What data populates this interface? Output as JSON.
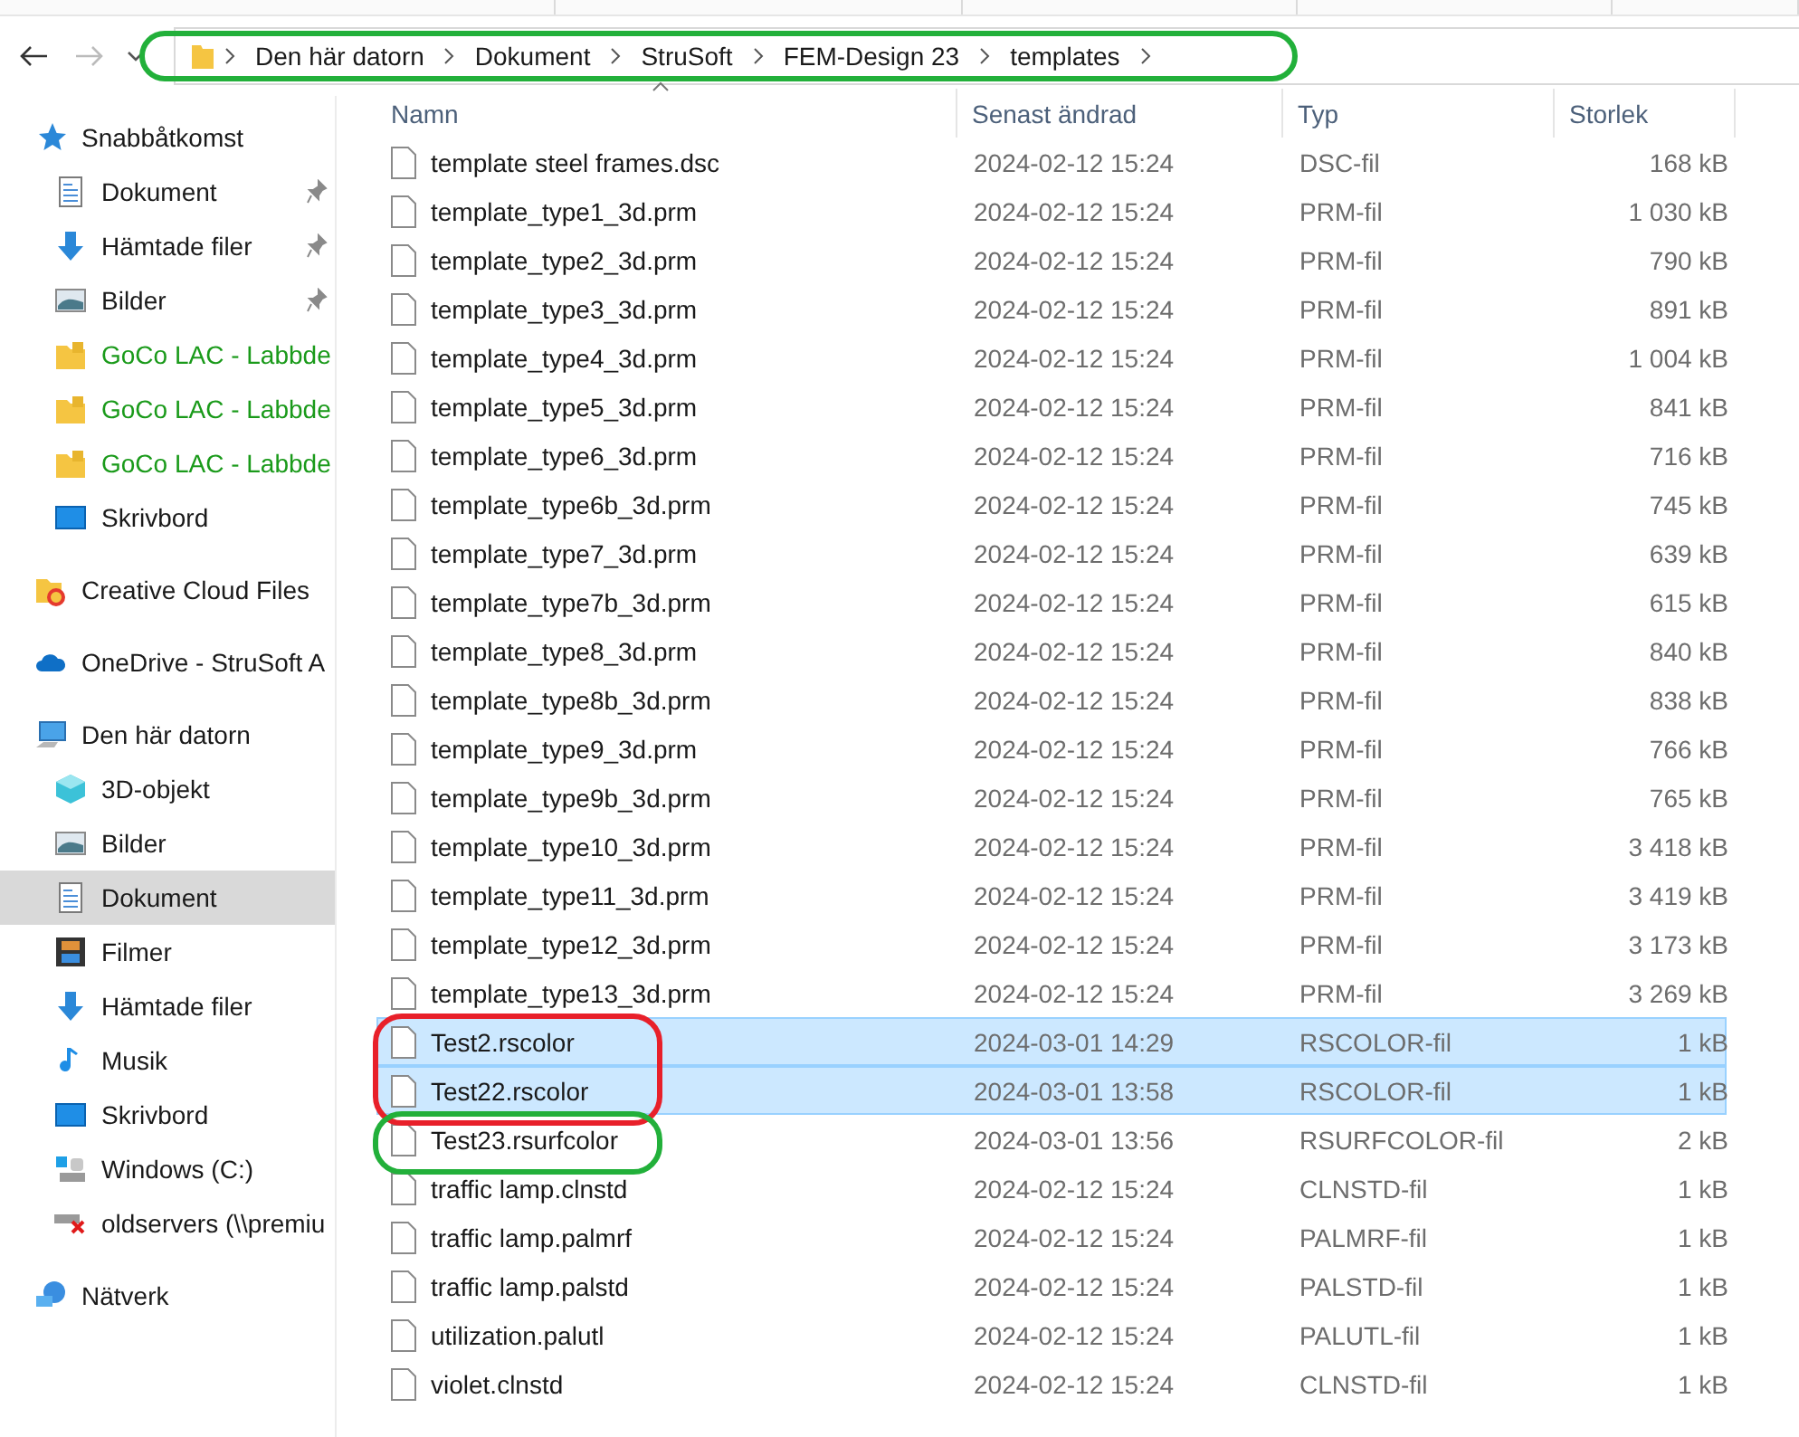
{
  "address_bar": {
    "color": "#22b03a",
    "crumbs": [
      "Den här datorn",
      "Dokument",
      "StruSoft",
      "FEM-Design 23",
      "templates"
    ]
  },
  "sidebar": {
    "sections": [
      {
        "label": "Snabbåtkomst",
        "kind": "star",
        "selected": false,
        "children": [
          {
            "label": "Dokument",
            "kind": "document",
            "pinned": true,
            "selected": false
          },
          {
            "label": "Hämtade filer",
            "kind": "download",
            "pinned": true,
            "selected": false
          },
          {
            "label": "Bilder",
            "kind": "pictures",
            "pinned": true,
            "selected": false
          },
          {
            "label": "GoCo LAC - Labbde",
            "kind": "lockfolder",
            "color": "#1a9a1a",
            "pinned": false,
            "selected": false
          },
          {
            "label": "GoCo LAC - Labbde",
            "kind": "lockfolder",
            "color": "#1a9a1a",
            "pinned": false,
            "selected": false
          },
          {
            "label": "GoCo LAC - Labbde",
            "kind": "lockfolder",
            "color": "#1a9a1a",
            "pinned": false,
            "selected": false
          },
          {
            "label": "Skrivbord",
            "kind": "desktop",
            "pinned": false,
            "selected": false
          }
        ]
      },
      {
        "label": "Creative Cloud Files",
        "kind": "ccfolder",
        "selected": false
      },
      {
        "label": "OneDrive - StruSoft A",
        "kind": "cloud",
        "selected": false
      },
      {
        "label": "Den här datorn",
        "kind": "pc",
        "selected": false,
        "children": [
          {
            "label": "3D-objekt",
            "kind": "cube",
            "pinned": false,
            "selected": false
          },
          {
            "label": "Bilder",
            "kind": "pictures",
            "pinned": false,
            "selected": false
          },
          {
            "label": "Dokument",
            "kind": "document",
            "pinned": false,
            "selected": true
          },
          {
            "label": "Filmer",
            "kind": "film",
            "pinned": false,
            "selected": false
          },
          {
            "label": "Hämtade filer",
            "kind": "download",
            "pinned": false,
            "selected": false
          },
          {
            "label": "Musik",
            "kind": "music",
            "pinned": false,
            "selected": false
          },
          {
            "label": "Skrivbord",
            "kind": "desktop",
            "pinned": false,
            "selected": false
          },
          {
            "label": "Windows (C:)",
            "kind": "drive",
            "pinned": false,
            "selected": false
          },
          {
            "label": "oldservers (\\\\premiu",
            "kind": "netdrive",
            "pinned": false,
            "selected": false
          }
        ]
      },
      {
        "label": "Nätverk",
        "kind": "network",
        "selected": false
      }
    ]
  },
  "table": {
    "columns": [
      "Namn",
      "Senast ändrad",
      "Typ",
      "Storlek"
    ],
    "rows": [
      {
        "name": "template steel frames.dsc",
        "modified": "2024-02-12 15:24",
        "type": "DSC-fil",
        "size": "168 kB",
        "selected": false
      },
      {
        "name": "template_type1_3d.prm",
        "modified": "2024-02-12 15:24",
        "type": "PRM-fil",
        "size": "1 030 kB",
        "selected": false
      },
      {
        "name": "template_type2_3d.prm",
        "modified": "2024-02-12 15:24",
        "type": "PRM-fil",
        "size": "790 kB",
        "selected": false
      },
      {
        "name": "template_type3_3d.prm",
        "modified": "2024-02-12 15:24",
        "type": "PRM-fil",
        "size": "891 kB",
        "selected": false
      },
      {
        "name": "template_type4_3d.prm",
        "modified": "2024-02-12 15:24",
        "type": "PRM-fil",
        "size": "1 004 kB",
        "selected": false
      },
      {
        "name": "template_type5_3d.prm",
        "modified": "2024-02-12 15:24",
        "type": "PRM-fil",
        "size": "841 kB",
        "selected": false
      },
      {
        "name": "template_type6_3d.prm",
        "modified": "2024-02-12 15:24",
        "type": "PRM-fil",
        "size": "716 kB",
        "selected": false
      },
      {
        "name": "template_type6b_3d.prm",
        "modified": "2024-02-12 15:24",
        "type": "PRM-fil",
        "size": "745 kB",
        "selected": false
      },
      {
        "name": "template_type7_3d.prm",
        "modified": "2024-02-12 15:24",
        "type": "PRM-fil",
        "size": "639 kB",
        "selected": false
      },
      {
        "name": "template_type7b_3d.prm",
        "modified": "2024-02-12 15:24",
        "type": "PRM-fil",
        "size": "615 kB",
        "selected": false
      },
      {
        "name": "template_type8_3d.prm",
        "modified": "2024-02-12 15:24",
        "type": "PRM-fil",
        "size": "840 kB",
        "selected": false
      },
      {
        "name": "template_type8b_3d.prm",
        "modified": "2024-02-12 15:24",
        "type": "PRM-fil",
        "size": "838 kB",
        "selected": false
      },
      {
        "name": "template_type9_3d.prm",
        "modified": "2024-02-12 15:24",
        "type": "PRM-fil",
        "size": "766 kB",
        "selected": false
      },
      {
        "name": "template_type9b_3d.prm",
        "modified": "2024-02-12 15:24",
        "type": "PRM-fil",
        "size": "765 kB",
        "selected": false
      },
      {
        "name": "template_type10_3d.prm",
        "modified": "2024-02-12 15:24",
        "type": "PRM-fil",
        "size": "3 418 kB",
        "selected": false
      },
      {
        "name": "template_type11_3d.prm",
        "modified": "2024-02-12 15:24",
        "type": "PRM-fil",
        "size": "3 419 kB",
        "selected": false
      },
      {
        "name": "template_type12_3d.prm",
        "modified": "2024-02-12 15:24",
        "type": "PRM-fil",
        "size": "3 173 kB",
        "selected": false
      },
      {
        "name": "template_type13_3d.prm",
        "modified": "2024-02-12 15:24",
        "type": "PRM-fil",
        "size": "3 269 kB",
        "selected": false
      },
      {
        "name": "Test2.rscolor",
        "modified": "2024-03-01 14:29",
        "type": "RSCOLOR-fil",
        "size": "1 kB",
        "selected": true,
        "color": "#e8202a"
      },
      {
        "name": "Test22.rscolor",
        "modified": "2024-03-01 13:58",
        "type": "RSCOLOR-fil",
        "size": "1 kB",
        "selected": true,
        "color": "#e8202a"
      },
      {
        "name": "Test23.rsurfcolor",
        "modified": "2024-03-01 13:56",
        "type": "RSURFCOLOR-fil",
        "size": "2 kB",
        "selected": false,
        "color": "#22b03a"
      },
      {
        "name": "traffic lamp.clnstd",
        "modified": "2024-02-12 15:24",
        "type": "CLNSTD-fil",
        "size": "1 kB",
        "selected": false
      },
      {
        "name": "traffic lamp.palmrf",
        "modified": "2024-02-12 15:24",
        "type": "PALMRF-fil",
        "size": "1 kB",
        "selected": false
      },
      {
        "name": "traffic lamp.palstd",
        "modified": "2024-02-12 15:24",
        "type": "PALSTD-fil",
        "size": "1 kB",
        "selected": false
      },
      {
        "name": "utilization.palutl",
        "modified": "2024-02-12 15:24",
        "type": "PALUTL-fil",
        "size": "1 kB",
        "selected": false
      },
      {
        "name": "violet.clnstd",
        "modified": "2024-02-12 15:24",
        "type": "CLNSTD-fil",
        "size": "1 kB",
        "selected": false
      }
    ]
  }
}
